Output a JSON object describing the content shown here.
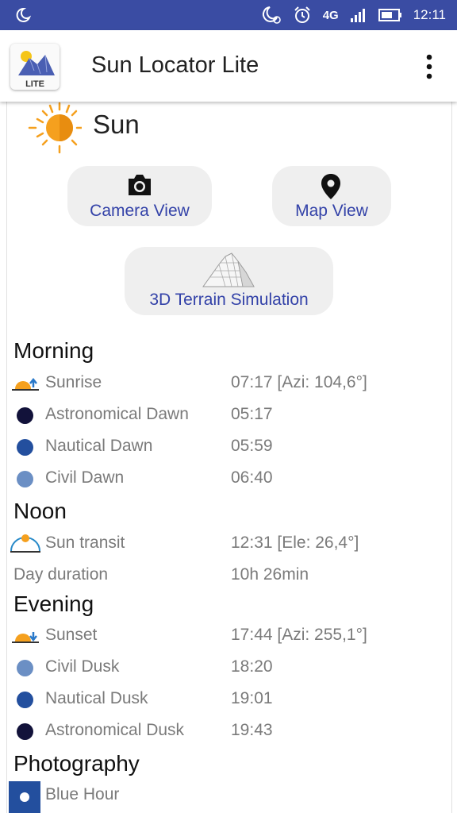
{
  "status_bar": {
    "network": "4G",
    "time": "12:11",
    "icons": [
      "moon-notification-icon",
      "moon-alarm-icon",
      "alarm-clock-icon",
      "signal-icon",
      "battery-icon"
    ]
  },
  "app_bar": {
    "title": "Sun Locator Lite",
    "logo_badge": "LITE",
    "menu_icon": "more-vert-icon"
  },
  "header": {
    "title": "Sun"
  },
  "buttons": {
    "camera": "Camera View",
    "map": "Map View",
    "terrain": "3D Terrain Simulation"
  },
  "morning": {
    "heading": "Morning",
    "rows": [
      {
        "label": "Sunrise",
        "value": "07:17 [Azi: 104,6°]"
      },
      {
        "label": "Astronomical Dawn",
        "value": "05:17"
      },
      {
        "label": "Nautical Dawn",
        "value": "05:59"
      },
      {
        "label": "Civil Dawn",
        "value": "06:40"
      }
    ]
  },
  "noon": {
    "heading": "Noon",
    "rows": [
      {
        "label": "Sun transit",
        "value": "12:31 [Ele: 26,4°]"
      },
      {
        "label": "Day duration",
        "value": "10h 26min"
      }
    ]
  },
  "evening": {
    "heading": "Evening",
    "rows": [
      {
        "label": "Sunset",
        "value": "17:44 [Azi: 255,1°]"
      },
      {
        "label": "Civil Dusk",
        "value": "18:20"
      },
      {
        "label": "Nautical Dusk",
        "value": "19:01"
      },
      {
        "label": "Astronomical Dusk",
        "value": "19:43"
      }
    ]
  },
  "photography": {
    "heading": "Photography",
    "rows": [
      {
        "label": "Blue Hour"
      }
    ]
  },
  "colors": {
    "status_bar": "#3a4ca3",
    "link_text": "#3342a8",
    "astronomical": "#12123a",
    "nautical": "#234f9e",
    "civil": "#6b8fc4",
    "sun_orange": "#f5a01e"
  }
}
